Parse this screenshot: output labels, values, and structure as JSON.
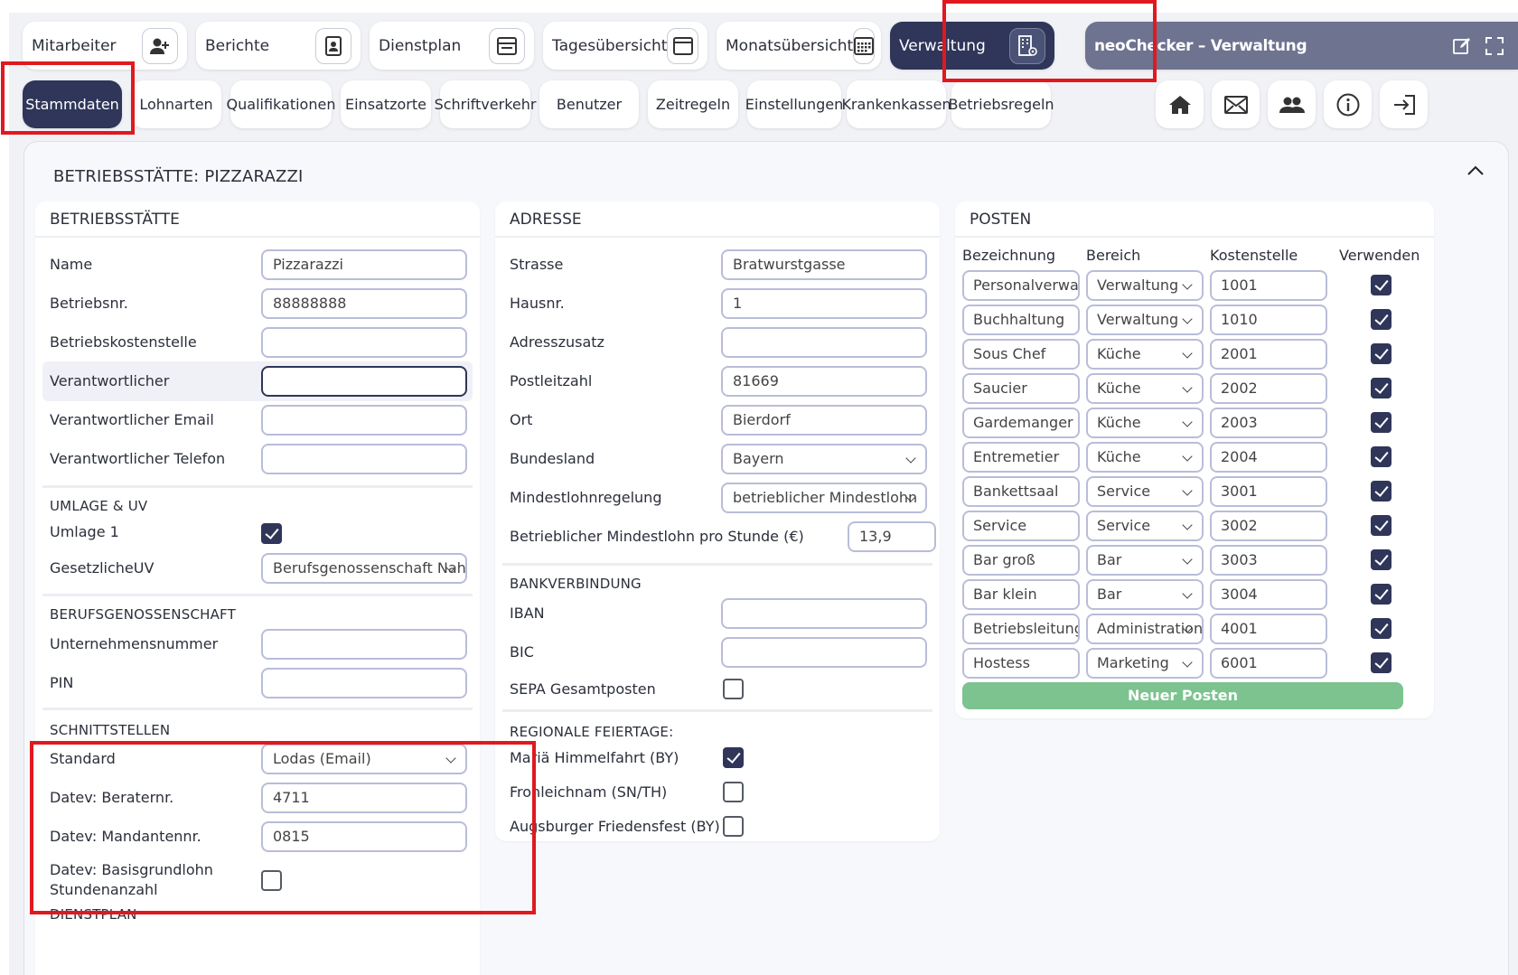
{
  "topnav": [
    {
      "label": "Mitarbeiter",
      "icon": "user-add-icon"
    },
    {
      "label": "Berichte",
      "icon": "document-person-icon"
    },
    {
      "label": "Dienstplan",
      "icon": "schedule-icon"
    },
    {
      "label": "Tagesübersicht",
      "icon": "calendar-day-icon"
    },
    {
      "label": "Monatsübersicht",
      "icon": "calendar-grid-icon"
    },
    {
      "label": "Verwaltung",
      "icon": "building-gear-icon"
    },
    {
      "label": "neoChecker – Verwaltung"
    }
  ],
  "subnav": [
    "Stammdaten",
    "Lohnarten",
    "Qualifikationen",
    "Einsatzorte",
    "Schriftverkehr",
    "Benutzer",
    "Zeitregeln",
    "Einstellungen",
    "Krankenkassen",
    "Betriebsregeln"
  ],
  "panel": {
    "title": "BETRIEBSSTÄTTE: PIZZARAZZI"
  },
  "betrieb": {
    "header": "BETRIEBSSTÄTTE",
    "fields": [
      {
        "label": "Name",
        "value": "Pizzarazzi"
      },
      {
        "label": "Betriebsnr.",
        "value": "88888888"
      },
      {
        "label": "Betriebskostenstelle",
        "value": ""
      },
      {
        "label": "Verantwortlicher",
        "value": ""
      },
      {
        "label": "Verantwortlicher Email",
        "value": ""
      },
      {
        "label": "Verantwortlicher Telefon",
        "value": ""
      }
    ],
    "umlage": {
      "header": "UMLAGE & UV",
      "umlage1_label": "Umlage 1",
      "umlage1_checked": true,
      "uv_label": "GesetzlicheUV",
      "uv_value": "Berufsgenossenschaft Nah"
    },
    "bg": {
      "header": "BERUFSGENOSSENSCHAFT",
      "unr_label": "Unternehmensnummer",
      "unr_value": "",
      "pin_label": "PIN",
      "pin_value": ""
    },
    "schnitt": {
      "header": "SCHNITTSTELLEN",
      "standard_label": "Standard",
      "standard_value": "Lodas (Email)",
      "berater_label": "Datev: Beraternr.",
      "berater_value": "4711",
      "mandant_label": "Datev: Mandantennr.",
      "mandant_value": "0815",
      "basis_label_1": "Datev: Basisgrundlohn",
      "basis_label_2": "Stundenanzahl",
      "basis_checked": false
    },
    "dienstplan_header": "DIENSTPLAN"
  },
  "adresse": {
    "header": "ADRESSE",
    "fields": [
      {
        "label": "Strasse",
        "value": "Bratwurstgasse"
      },
      {
        "label": "Hausnr.",
        "value": "1"
      },
      {
        "label": "Adresszusatz",
        "value": ""
      },
      {
        "label": "Postleitzahl",
        "value": "81669"
      },
      {
        "label": "Ort",
        "value": "Bierdorf"
      }
    ],
    "bundesland_label": "Bundesland",
    "bundesland_value": "Bayern",
    "mindest_label": "Mindestlohnregelung",
    "mindest_value": "betrieblicher Mindestlohn",
    "mindest_std_label": "Betrieblicher Mindestlohn pro Stunde (€)",
    "mindest_std_value": "13,9",
    "bank": {
      "header": "BANKVERBINDUNG",
      "iban_label": "IBAN",
      "iban_value": "",
      "bic_label": "BIC",
      "bic_value": "",
      "sepa_label": "SEPA Gesamtposten",
      "sepa_checked": false
    },
    "feiertage": {
      "header": "REGIONALE FEIERTAGE:",
      "items": [
        {
          "label": "Mariä Himmelfahrt (BY)",
          "checked": true
        },
        {
          "label": "Fronleichnam (SN/TH)",
          "checked": false
        },
        {
          "label": "Augsburger Friedensfest (BY)",
          "checked": false
        }
      ]
    }
  },
  "posten": {
    "header": "POSTEN",
    "columns": [
      "Bezeichnung",
      "Bereich",
      "Kostenstelle",
      "Verwenden"
    ],
    "rows": [
      {
        "name": "Personalverwaltung",
        "bereich": "Verwaltung",
        "kst": "1001",
        "use": true
      },
      {
        "name": "Buchhaltung",
        "bereich": "Verwaltung",
        "kst": "1010",
        "use": true
      },
      {
        "name": "Sous Chef",
        "bereich": "Küche",
        "kst": "2001",
        "use": true
      },
      {
        "name": "Saucier",
        "bereich": "Küche",
        "kst": "2002",
        "use": true
      },
      {
        "name": "Gardemanger",
        "bereich": "Küche",
        "kst": "2003",
        "use": true
      },
      {
        "name": "Entremetier",
        "bereich": "Küche",
        "kst": "2004",
        "use": true
      },
      {
        "name": "Bankettsaal",
        "bereich": "Service",
        "kst": "3001",
        "use": true
      },
      {
        "name": "Service",
        "bereich": "Service",
        "kst": "3002",
        "use": true
      },
      {
        "name": "Bar groß",
        "bereich": "Bar",
        "kst": "3003",
        "use": true
      },
      {
        "name": "Bar klein",
        "bereich": "Bar",
        "kst": "3004",
        "use": true
      },
      {
        "name": "Betriebsleitung",
        "bereich": "Administration",
        "kst": "4001",
        "use": true
      },
      {
        "name": "Hostess",
        "bereich": "Marketing",
        "kst": "6001",
        "use": true
      }
    ],
    "new_label": "Neuer Posten"
  },
  "colors": {
    "primary": "#2f3659",
    "accent_green": "#7cc38f",
    "highlight_red": "#e0191f"
  }
}
